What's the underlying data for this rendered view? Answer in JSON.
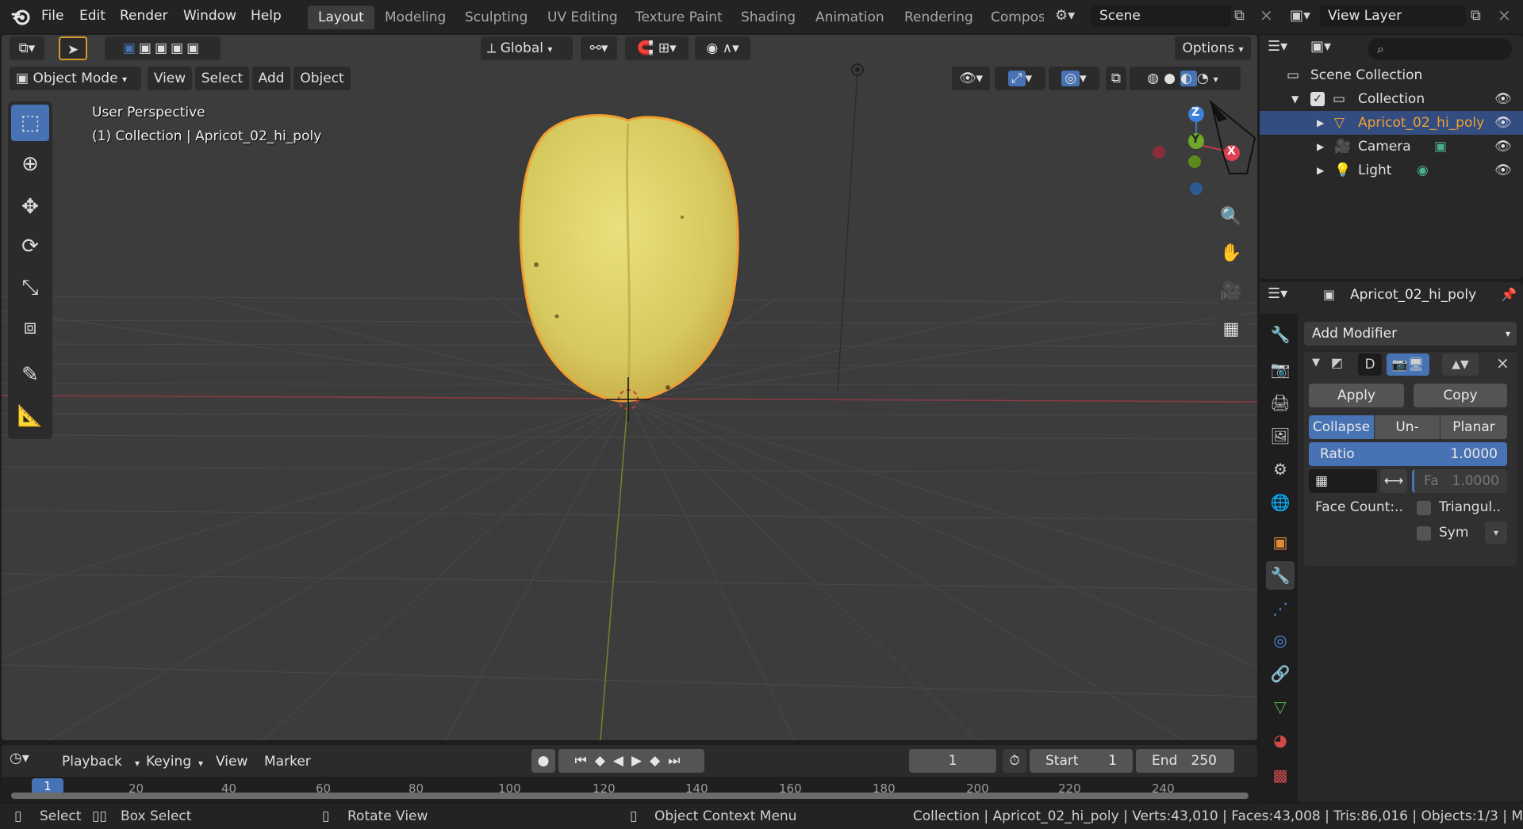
{
  "topbar": {
    "menus": [
      "File",
      "Edit",
      "Render",
      "Window",
      "Help"
    ],
    "workspaces": [
      "Layout",
      "Modeling",
      "Sculpting",
      "UV Editing",
      "Texture Paint",
      "Shading",
      "Animation",
      "Rendering",
      "Compos"
    ],
    "active_workspace": "Layout",
    "scene": "Scene",
    "view_layer": "View Layer"
  },
  "tool_header": {
    "transform_orientation": "Global",
    "options_label": "Options"
  },
  "viewport_header": {
    "mode": "Object Mode",
    "menus": [
      "View",
      "Select",
      "Add",
      "Object"
    ]
  },
  "viewport": {
    "perspective_label": "User Perspective",
    "context_label": "(1) Collection | Apricot_02_hi_poly",
    "gizmo_axes": {
      "z": "Z",
      "y": "Y",
      "x": "X"
    },
    "colors": {
      "background": "#3c3c3c",
      "grid": "#4a4a4a",
      "x_axis": "#8a3b45",
      "y_axis": "#6b8a2a",
      "apricot": "#d9cf6a",
      "selection": "#f0a030"
    }
  },
  "toolbar": {
    "tools": [
      "select-box-icon",
      "cursor-icon",
      "move-icon",
      "rotate-icon",
      "scale-icon",
      "transform-icon",
      "annotate-icon",
      "measure-icon"
    ],
    "active": "select-box-icon"
  },
  "timeline": {
    "menus": [
      "Playback",
      "Keying",
      "View",
      "Marker"
    ],
    "current_frame": "1",
    "start_label": "Start",
    "start_value": "1",
    "end_label": "End",
    "end_value": "250",
    "ruler": [
      "20",
      "40",
      "60",
      "80",
      "100",
      "120",
      "140",
      "160",
      "180",
      "200",
      "220",
      "240"
    ],
    "ruler_current": "1"
  },
  "statusbar": {
    "select": "Select",
    "box_select": "Box Select",
    "rotate_view": "Rotate View",
    "context_menu": "Object Context Menu",
    "stats": "Collection | Apricot_02_hi_poly | Verts:43,010 | Faces:43,008 | Tris:86,016 | Objects:1/3 | M"
  },
  "outliner": {
    "root": "Scene Collection",
    "collection": "Collection",
    "items": [
      {
        "label": "Apricot_02_hi_poly",
        "selected": true,
        "icon": "mesh-icon"
      },
      {
        "label": "Camera",
        "selected": false,
        "icon": "camera-icon"
      },
      {
        "label": "Light",
        "selected": false,
        "icon": "light-icon"
      }
    ]
  },
  "properties": {
    "object_name": "Apricot_02_hi_poly",
    "add_modifier": "Add Modifier",
    "modifier_name": "D",
    "apply": "Apply",
    "copy": "Copy",
    "modes": [
      "Collapse",
      "Un-Subd..",
      "Planar"
    ],
    "active_mode": "Collapse",
    "ratio_label": "Ratio",
    "ratio_value": "1.0000",
    "factor_label": "Fa",
    "factor_value": "1.0000",
    "face_count_label": "Face Count:..",
    "triangulate_label": "Triangul..",
    "symmetry_label": "Sym"
  }
}
